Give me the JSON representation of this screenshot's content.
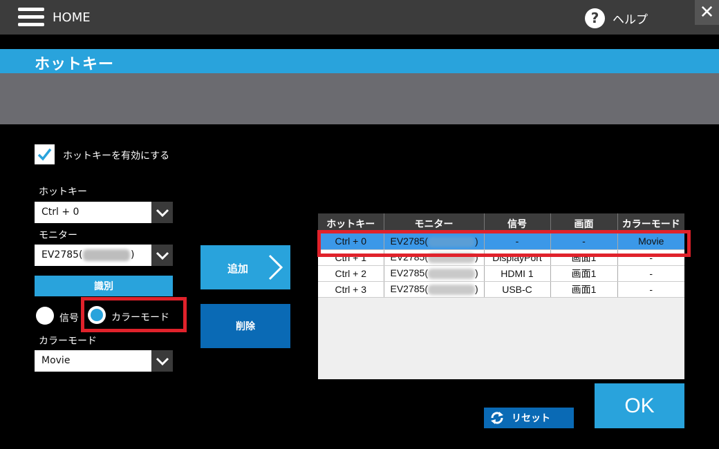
{
  "header": {
    "home_label": "HOME",
    "help_glyph": "?",
    "help_label": "ヘルプ",
    "close_glyph": "✕"
  },
  "page": {
    "title": "ホットキー"
  },
  "settings": {
    "enable_label": "ホットキーを有効にする",
    "enable_checked": true,
    "hotkey_label": "ホットキー",
    "hotkey_value": "Ctrl + 0",
    "monitor_label": "モニター",
    "monitor_value_prefix": "EV2785(",
    "monitor_value_suffix": ")",
    "identify_label": "識別",
    "radio_signal_label": "信号",
    "radio_colormode_label": "カラーモード",
    "selected_radio": "colormode",
    "colormode_label": "カラーモード",
    "colormode_value": "Movie"
  },
  "actions": {
    "add_label": "追加",
    "delete_label": "削除",
    "reset_label": "リセット",
    "ok_label": "OK"
  },
  "table": {
    "headers": [
      "ホットキー",
      "モニター",
      "信号",
      "画面",
      "カラーモード"
    ],
    "rows": [
      {
        "hotkey": "Ctrl + 0",
        "monitor_prefix": "EV2785(",
        "monitor_suffix": ")",
        "signal": "-",
        "screen": "-",
        "colormode": "Movie"
      },
      {
        "hotkey": "Ctrl + 1",
        "monitor_prefix": "EV2785(",
        "monitor_suffix": ")",
        "signal": "DisplayPort",
        "screen": "画面1",
        "colormode": "-"
      },
      {
        "hotkey": "Ctrl + 2",
        "monitor_prefix": "EV2785(",
        "monitor_suffix": ")",
        "signal": "HDMI 1",
        "screen": "画面1",
        "colormode": "-"
      },
      {
        "hotkey": "Ctrl + 3",
        "monitor_prefix": "EV2785(",
        "monitor_suffix": ")",
        "signal": "USB-C",
        "screen": "画面1",
        "colormode": "-"
      }
    ],
    "selected_row": 0
  },
  "colors": {
    "accent": "#29a3dc",
    "dark_accent": "#0a6ab5",
    "highlight": "#e0222b",
    "topbar": "#3c3c3c"
  },
  "icons": {
    "menu": "hamburger-icon",
    "help": "question-circle-icon",
    "close": "close-icon",
    "check": "checkmark-icon",
    "dropdown": "chevron-down-icon",
    "add": "chevron-right-icon",
    "reset": "refresh-icon"
  }
}
